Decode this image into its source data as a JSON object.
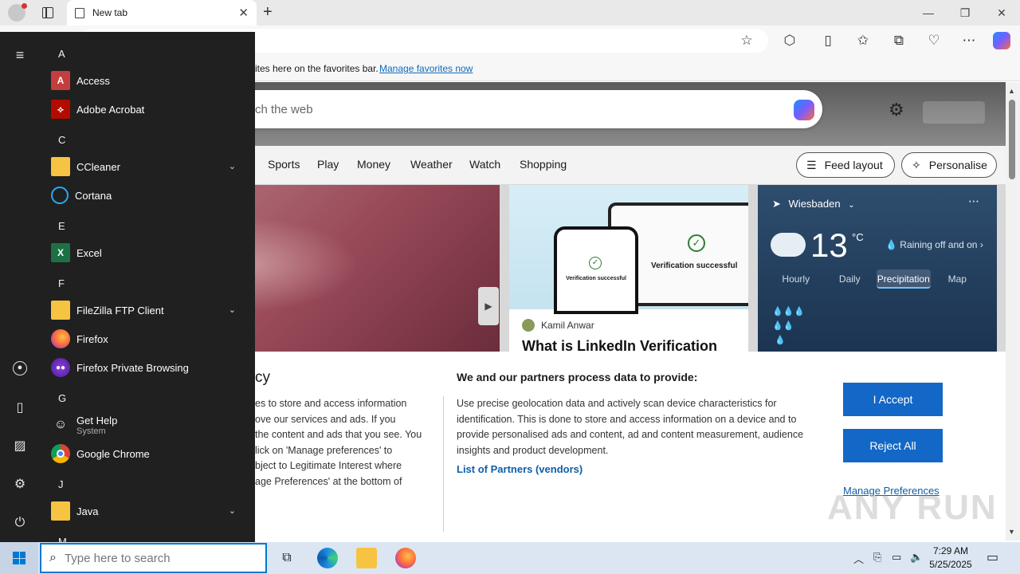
{
  "browser": {
    "tab_title": "New tab",
    "tab_close": "✕",
    "new_tab": "+",
    "window_controls": {
      "minimize": "—",
      "restore": "❐",
      "close": "✕"
    },
    "favorites_bar": {
      "text": "ites here on the favorites bar.",
      "link": "Manage favorites now"
    }
  },
  "ntp": {
    "search_placeholder": "ch the web",
    "nav": [
      "Sports",
      "Play",
      "Money",
      "Weather",
      "Watch",
      "Shopping"
    ],
    "feed_layout": "Feed layout",
    "personalise": "Personalise",
    "article": {
      "author": "Kamil Anwar",
      "headline": "What is LinkedIn Verification",
      "phone_text": "Verification successful",
      "laptop_text": "Verification successful"
    },
    "weather": {
      "location": "Wiesbaden",
      "temperature": "13",
      "unit": "°C",
      "condition": "Raining off and on",
      "tabs": [
        "Hourly",
        "Daily",
        "Precipitation",
        "Map"
      ],
      "selected_tab": "Precipitation"
    }
  },
  "consent": {
    "title": "cy",
    "left_text": "es to store and access information\nove our services and ads. If you\nthe content and ads that you see. You\nlick on 'Manage preferences' to\nbject to Legitimate Interest where\nage Preferences' at the bottom of",
    "heading": "We and our partners process data to provide:",
    "body": "Use precise geolocation data and actively scan device characteristics for identification. This is done to store and access information on a device and to provide personalised ads and content, ad and content measurement, audience insights and product development.",
    "partners_link": "List of Partners (vendors)",
    "accept": "I Accept",
    "reject": "Reject All",
    "manage": "Manage Preferences"
  },
  "watermark": "ANY RUN",
  "start_menu": {
    "sections": [
      {
        "letter": "A",
        "apps": [
          {
            "name": "Access",
            "icon": "access-icon",
            "color": "#c43e3e",
            "glyph": "A"
          },
          {
            "name": "Adobe Acrobat",
            "icon": "acrobat-icon",
            "color": "#b30b00",
            "glyph": "⟡"
          }
        ]
      },
      {
        "letter": "C",
        "apps": [
          {
            "name": "CCleaner",
            "icon": "folder-icon",
            "folder": true
          },
          {
            "name": "Cortana",
            "icon": "cortana-icon"
          }
        ]
      },
      {
        "letter": "E",
        "apps": [
          {
            "name": "Excel",
            "icon": "excel-icon",
            "color": "#1d7044",
            "glyph": "X"
          }
        ]
      },
      {
        "letter": "F",
        "apps": [
          {
            "name": "FileZilla FTP Client",
            "icon": "folder-icon",
            "folder": true
          },
          {
            "name": "Firefox",
            "icon": "firefox-icon"
          },
          {
            "name": "Firefox Private Browsing",
            "icon": "firefox-private-icon"
          }
        ]
      },
      {
        "letter": "G",
        "apps": [
          {
            "name": "Get Help",
            "sub": "System",
            "icon": "get-help-icon"
          },
          {
            "name": "Google Chrome",
            "icon": "chrome-icon"
          }
        ]
      },
      {
        "letter": "J",
        "apps": [
          {
            "name": "Java",
            "icon": "folder-icon",
            "folder": true
          }
        ]
      },
      {
        "letter": "M",
        "apps": []
      }
    ]
  },
  "taskbar": {
    "search_placeholder": "Type here to search",
    "time": "7:29 AM",
    "date": "5/25/2025"
  },
  "colors": {
    "accent": "#1367c6",
    "start_bg": "#202020",
    "link": "#0f6cbd"
  }
}
